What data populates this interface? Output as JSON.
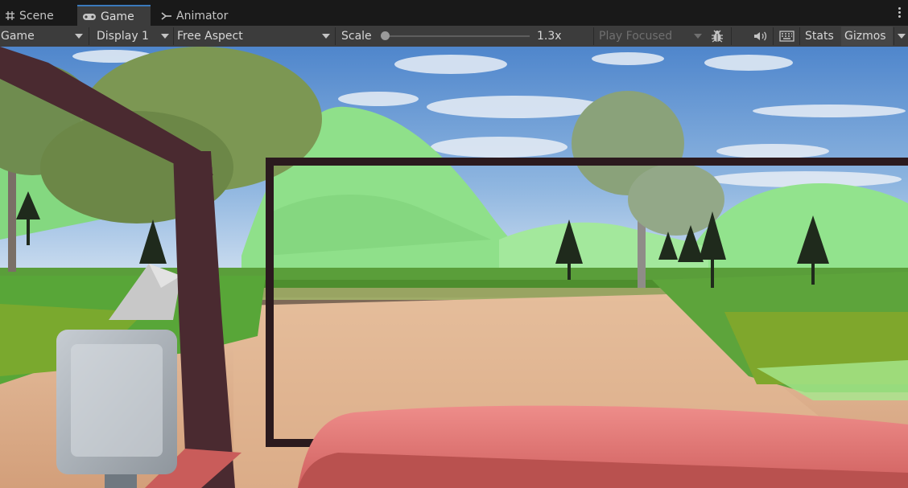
{
  "tabs": [
    {
      "label": "Scene",
      "icon": "grid-icon"
    },
    {
      "label": "Game",
      "icon": "gamepad-icon",
      "active": true
    },
    {
      "label": "Animator",
      "icon": "animator-icon"
    }
  ],
  "toolbar": {
    "view_select": "Game",
    "display_select": "Display 1",
    "aspect_select": "Free Aspect",
    "scale_label": "Scale",
    "scale_value": "1.3x",
    "scale_fraction": 0.0,
    "play_mode_select": "Play Focused",
    "stats_label": "Stats",
    "gizmos_label": "Gizmos"
  },
  "icons": [
    "bug-icon",
    "audio-icon",
    "keyboard-icon",
    "more-menu-icon"
  ],
  "colors": {
    "accent": "#3a79bb",
    "toolbar_bg": "#3c3c3c",
    "tabbar_bg": "#191919",
    "sky": "#6f9fd6",
    "hill_green": "#8fe28a",
    "dirt": "#dcae8a",
    "car_hood": "#e47a78",
    "frame_dark": "#4a2a30"
  }
}
